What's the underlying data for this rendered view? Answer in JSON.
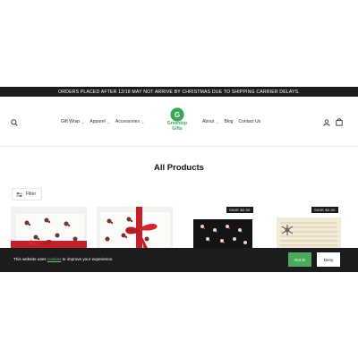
{
  "announcement": "ORDERS PLACED AFTER 12/18 MAY NOT ARRIVE BY CHRISTMAS DUE TO SHIPPING CARRIER DELAYS.",
  "header": {
    "search_icon": "search-icon",
    "nav_left": [
      "Gift Wrap",
      "Apparel",
      "Accessories"
    ],
    "nav_right": [
      "About",
      "Blog",
      "Contact Us"
    ],
    "logo_line1": "Greentop",
    "logo_line2": "Gifts",
    "account_icon": "user-icon",
    "cart_icon": "cart-icon"
  },
  "main": {
    "title": "All Products",
    "filter_label": "Filter"
  },
  "products": [
    {
      "badge": ""
    },
    {
      "badge": ""
    },
    {
      "badge": "SAVE $2.00"
    },
    {
      "badge": "SAVE $2.00"
    }
  ],
  "cookie": {
    "text_before": "This website uses ",
    "link": "cookies",
    "text_after": " to improve your experience.",
    "accept": "Got it!",
    "deny": "Deny"
  },
  "colors": {
    "brand_green": "#3aa657",
    "announce_bg": "#1c1c1c",
    "accept_green": "#4cab5a"
  }
}
